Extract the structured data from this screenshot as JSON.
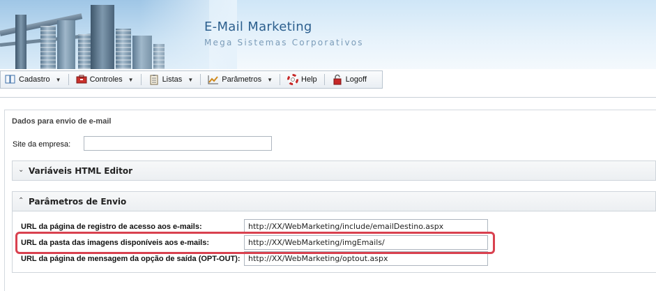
{
  "banner": {
    "title": "E-Mail Marketing",
    "subtitle": "Mega Sistemas Corporativos"
  },
  "menu": [
    {
      "label": "Cadastro",
      "icon": "book-icon",
      "has_dropdown": true
    },
    {
      "label": "Controles",
      "icon": "toolbox-icon",
      "has_dropdown": true
    },
    {
      "label": "Listas",
      "icon": "clipboard-icon",
      "has_dropdown": true
    },
    {
      "label": "Parâmetros",
      "icon": "chart-icon",
      "has_dropdown": true
    },
    {
      "label": "Help",
      "icon": "lifebuoy-icon",
      "has_dropdown": false
    },
    {
      "label": "Logoff",
      "icon": "lock-icon",
      "has_dropdown": false
    }
  ],
  "form": {
    "section_title": "Dados para envio de e-mail",
    "site_label": "Site da empresa:",
    "site_value": "",
    "panel_html_editor": "Variáveis HTML Editor",
    "panel_envio": "Parâmetros de Envio",
    "fields": [
      {
        "label": "URL da página de registro de acesso aos e-mails:",
        "value": "http://XX/WebMarketing/include/emailDestino.aspx"
      },
      {
        "label": "URL da pasta das imagens disponíveis aos e-mails:",
        "value": "http://XX/WebMarketing/imgEmails/"
      },
      {
        "label": "URL da página de mensagem da opção de saída (OPT-OUT):",
        "value": "http://XX/WebMarketing/optout.aspx"
      }
    ]
  },
  "colors": {
    "highlight": "#d9414f",
    "title": "#2c5f8e"
  }
}
